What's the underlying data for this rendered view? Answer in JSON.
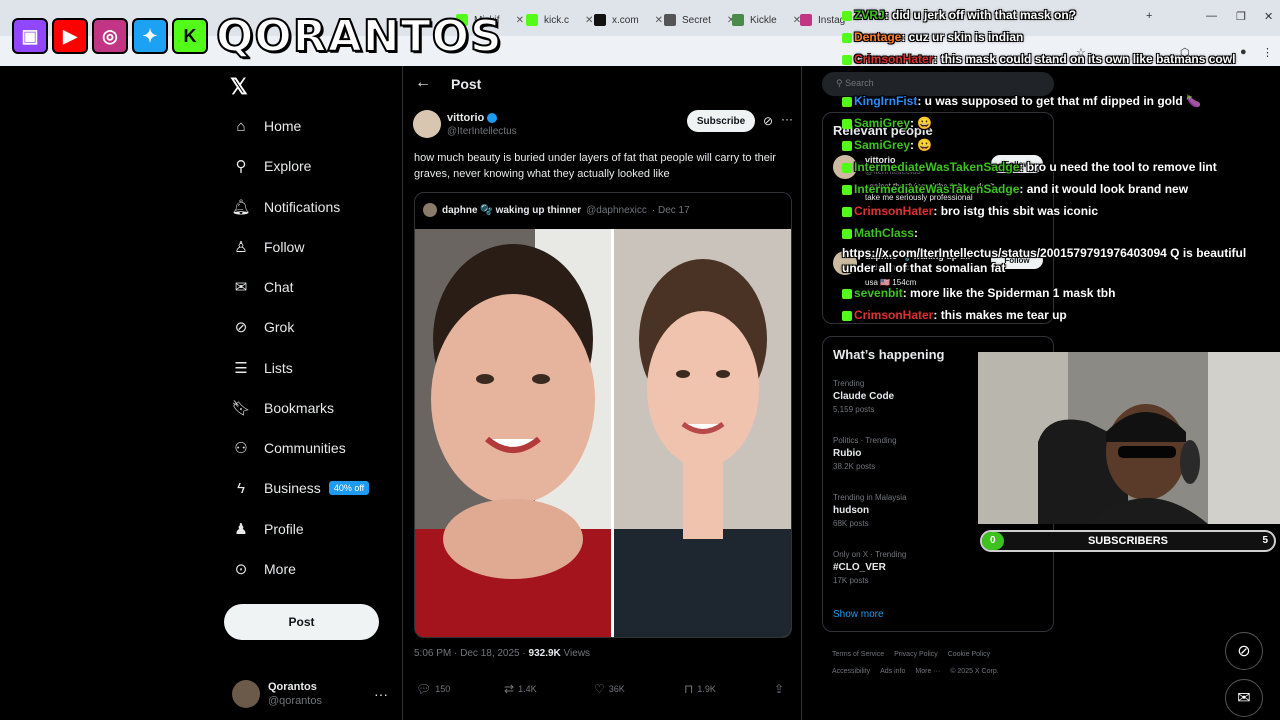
{
  "browser": {
    "tabs": [
      {
        "label": "Mizkif",
        "color": "#53fc18"
      },
      {
        "label": "kick.c",
        "color": "#53fc18"
      },
      {
        "label": "x.com",
        "color": "#111111"
      },
      {
        "label": "Secret",
        "color": "#555555"
      },
      {
        "label": "Kickle",
        "color": "#4a8a4a"
      },
      {
        "label": "Instag",
        "color": "#c13584"
      }
    ]
  },
  "overlay": {
    "brand": "QORANTOS",
    "social_icons": [
      "twitch-icon",
      "youtube-icon",
      "instagram-icon",
      "twitter-icon",
      "kick-icon"
    ],
    "colors": {
      "twitch": "#9146ff",
      "youtube": "#ff0000",
      "instagram": "#c13584",
      "twitter": "#1da1f2",
      "kick": "#53fc18"
    }
  },
  "nav": {
    "items": [
      {
        "label": "Home",
        "icon": "home-icon"
      },
      {
        "label": "Explore",
        "icon": "search-icon"
      },
      {
        "label": "Notifications",
        "icon": "bell-icon"
      },
      {
        "label": "Follow",
        "icon": "add-person-icon"
      },
      {
        "label": "Chat",
        "icon": "mail-icon"
      },
      {
        "label": "Grok",
        "icon": "grok-icon"
      },
      {
        "label": "Lists",
        "icon": "list-icon"
      },
      {
        "label": "Bookmarks",
        "icon": "bookmark-icon"
      },
      {
        "label": "Communities",
        "icon": "people-icon"
      },
      {
        "label": "Business",
        "icon": "lightning-icon"
      },
      {
        "label": "Profile",
        "icon": "person-icon"
      },
      {
        "label": "More",
        "icon": "more-circle-icon"
      }
    ],
    "business_badge": "40% off",
    "post_button": "Post",
    "account": {
      "name": "Qorantos",
      "handle": "@qorantos"
    }
  },
  "post": {
    "header_title": "Post",
    "author_name": "vittorio",
    "author_handle": "@IterIntellectus",
    "subscribe": "Subscribe",
    "text": "how much beauty is buried under layers of fat that people will carry to their graves, never knowing what they actually looked like",
    "quote": {
      "name": "daphne 🫧 waking up thinner",
      "handle": "@daphnexicc",
      "date": "· Dec 17"
    },
    "time": "5:06 PM · Dec 18, 2025 ·",
    "views": "932.9K",
    "views_label": "Views",
    "actions": {
      "replies": "150",
      "reposts": "1.4K",
      "likes": "36K",
      "bookmarks": "1.9K"
    }
  },
  "right": {
    "search_placeholder": "Search",
    "relevant_title": "Relevant people",
    "relevant": [
      {
        "name": "vittorio",
        "handle": "@IterIntellectus",
        "bio": "against the dying of the light — don't take me seriously professional",
        "follow": "Follow"
      },
      {
        "name": "daphne 🫧 waking up t...",
        "handle": "@daphnexicc",
        "bio": "usa 🇺🇸 154cm",
        "follow": "Follow"
      }
    ],
    "happening_title": "What’s happening",
    "trends": [
      {
        "context": "Trending",
        "title": "Claude Code",
        "posts": "5,159 posts"
      },
      {
        "context": "Politics · Trending",
        "title": "Rubio",
        "posts": "38.2K posts"
      },
      {
        "context": "Trending in Malaysia",
        "title": "hudson",
        "posts": "68K posts"
      },
      {
        "context": "Only on X · Trending",
        "title": "#CLO_VER",
        "posts": "17K posts"
      }
    ],
    "show_more": "Show more",
    "footer": [
      "Terms of Service",
      "Privacy Policy",
      "Cookie Policy",
      "Accessibility",
      "Ads info",
      "More ···",
      "© 2025 X Corp."
    ]
  },
  "chat": [
    {
      "user": "ZVRJ",
      "color": "#3ec21f",
      "msg": ": did u jerk off with that mask on?"
    },
    {
      "user": "Dentage",
      "color": "#ff7f27",
      "msg": ": cuz ur skin is indian"
    },
    {
      "user": "CrimsonHater",
      "color": "#e03030",
      "msg": ": this mask could stand on its own like batmans cowl"
    },
    {
      "user": "KingIrnFist",
      "color": "#2a8cff",
      "msg": ": u was supposed to get that mf dipped in gold 🍆"
    },
    {
      "user": "SamiGrey",
      "color": "#3ec21f",
      "msg": ": 😀"
    },
    {
      "user": "SamiGrey",
      "color": "#3ec21f",
      "msg": ": 😀"
    },
    {
      "user": "IntermediateWasTakenSadge",
      "color": "#3ec21f",
      "msg": ": bro u need the tool to remove lint"
    },
    {
      "user": "IntermediateWasTakenSadge",
      "color": "#3ec21f",
      "msg": ": and it would look brand new"
    },
    {
      "user": "CrimsonHater",
      "color": "#e03030",
      "msg": ": bro istg this sbit was iconic"
    },
    {
      "user": "MathClass",
      "color": "#3ec21f",
      "msg": ":"
    },
    {
      "user": "",
      "color": "#ffffff",
      "msg": "https://x.com/IterIntellectus/status/2001579791976403094 Q is beautiful under all of that somalian fat"
    },
    {
      "user": "sevenbit",
      "color": "#3ec21f",
      "msg": ": more like the Spiderman 1 mask tbh"
    },
    {
      "user": "CrimsonHater",
      "color": "#e03030",
      "msg": ": this makes me tear up"
    }
  ],
  "subs": {
    "current": "0",
    "label": "SUBSCRIBERS",
    "goal": "5",
    "progress": 0.05
  }
}
